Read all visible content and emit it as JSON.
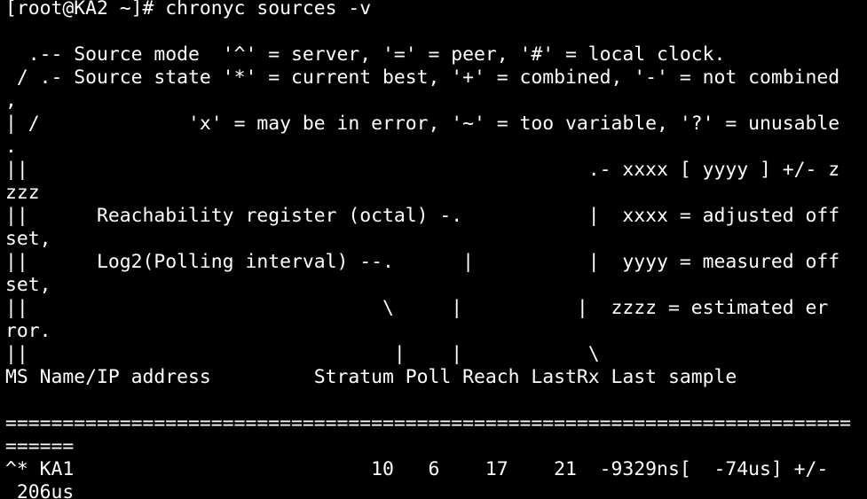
{
  "terminal": {
    "lines": [
      "[root@KA2 ~]# chronyc sources -v",
      "",
      "  .-- Source mode  '^' = server, '=' = peer, '#' = local clock.",
      " / .- Source state '*' = current best, '+' = combined, '-' = not combined",
      ",",
      "| /             'x' = may be in error, '~' = too variable, '?' = unusable",
      ".",
      "||                                                 .- xxxx [ yyyy ] +/- z",
      "zzz",
      "||      Reachability register (octal) -.           |  xxxx = adjusted off",
      "set,",
      "||      Log2(Polling interval) --.      |          |  yyyy = measured off",
      "set,",
      "||                               \\     |          |  zzzz = estimated er",
      "ror.",
      "||                                |    |           \\",
      "MS Name/IP address         Stratum Poll Reach LastRx Last sample",
      "",
      "==========================================================================",
      "======",
      "^* KA1                          10   6    17    21  -9329ns[  -74us] +/-",
      " 206us"
    ]
  }
}
